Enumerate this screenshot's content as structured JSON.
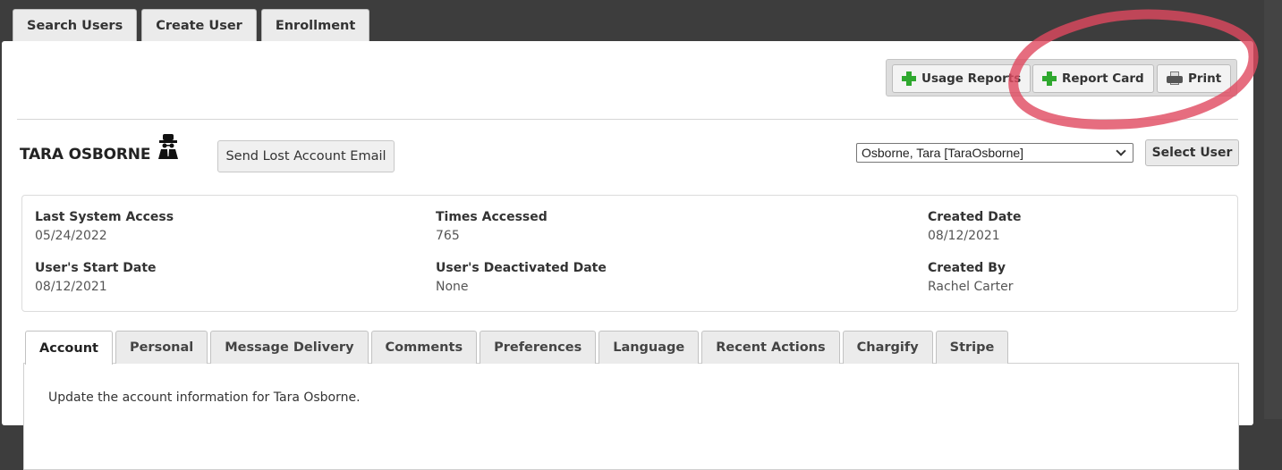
{
  "top_tabs": [
    "Search Users",
    "Create User",
    "Enrollment"
  ],
  "toolbar": {
    "usage_reports": "Usage Reports",
    "report_card": "Report Card",
    "print": "Print"
  },
  "user": {
    "name": "TARA OSBORNE",
    "lost_account_button": "Send Lost Account Email",
    "selected_user": "Osborne, Tara [TaraOsborne]",
    "select_user_button": "Select User"
  },
  "info": {
    "last_access_label": "Last System Access",
    "last_access_value": "05/24/2022",
    "times_accessed_label": "Times Accessed",
    "times_accessed_value": "765",
    "created_date_label": "Created Date",
    "created_date_value": "08/12/2021",
    "start_date_label": "User's Start Date",
    "start_date_value": "08/12/2021",
    "deactivated_label": "User's Deactivated Date",
    "deactivated_value": "None",
    "created_by_label": "Created By",
    "created_by_value": "Rachel Carter"
  },
  "sub_tabs": [
    "Account",
    "Personal",
    "Message Delivery",
    "Comments",
    "Preferences",
    "Language",
    "Recent Actions",
    "Chargify",
    "Stripe"
  ],
  "content": {
    "description": "Update the account information for Tara Osborne."
  },
  "colors": {
    "annotation": "#e0495f",
    "plus_icon": "#2fa82f"
  }
}
